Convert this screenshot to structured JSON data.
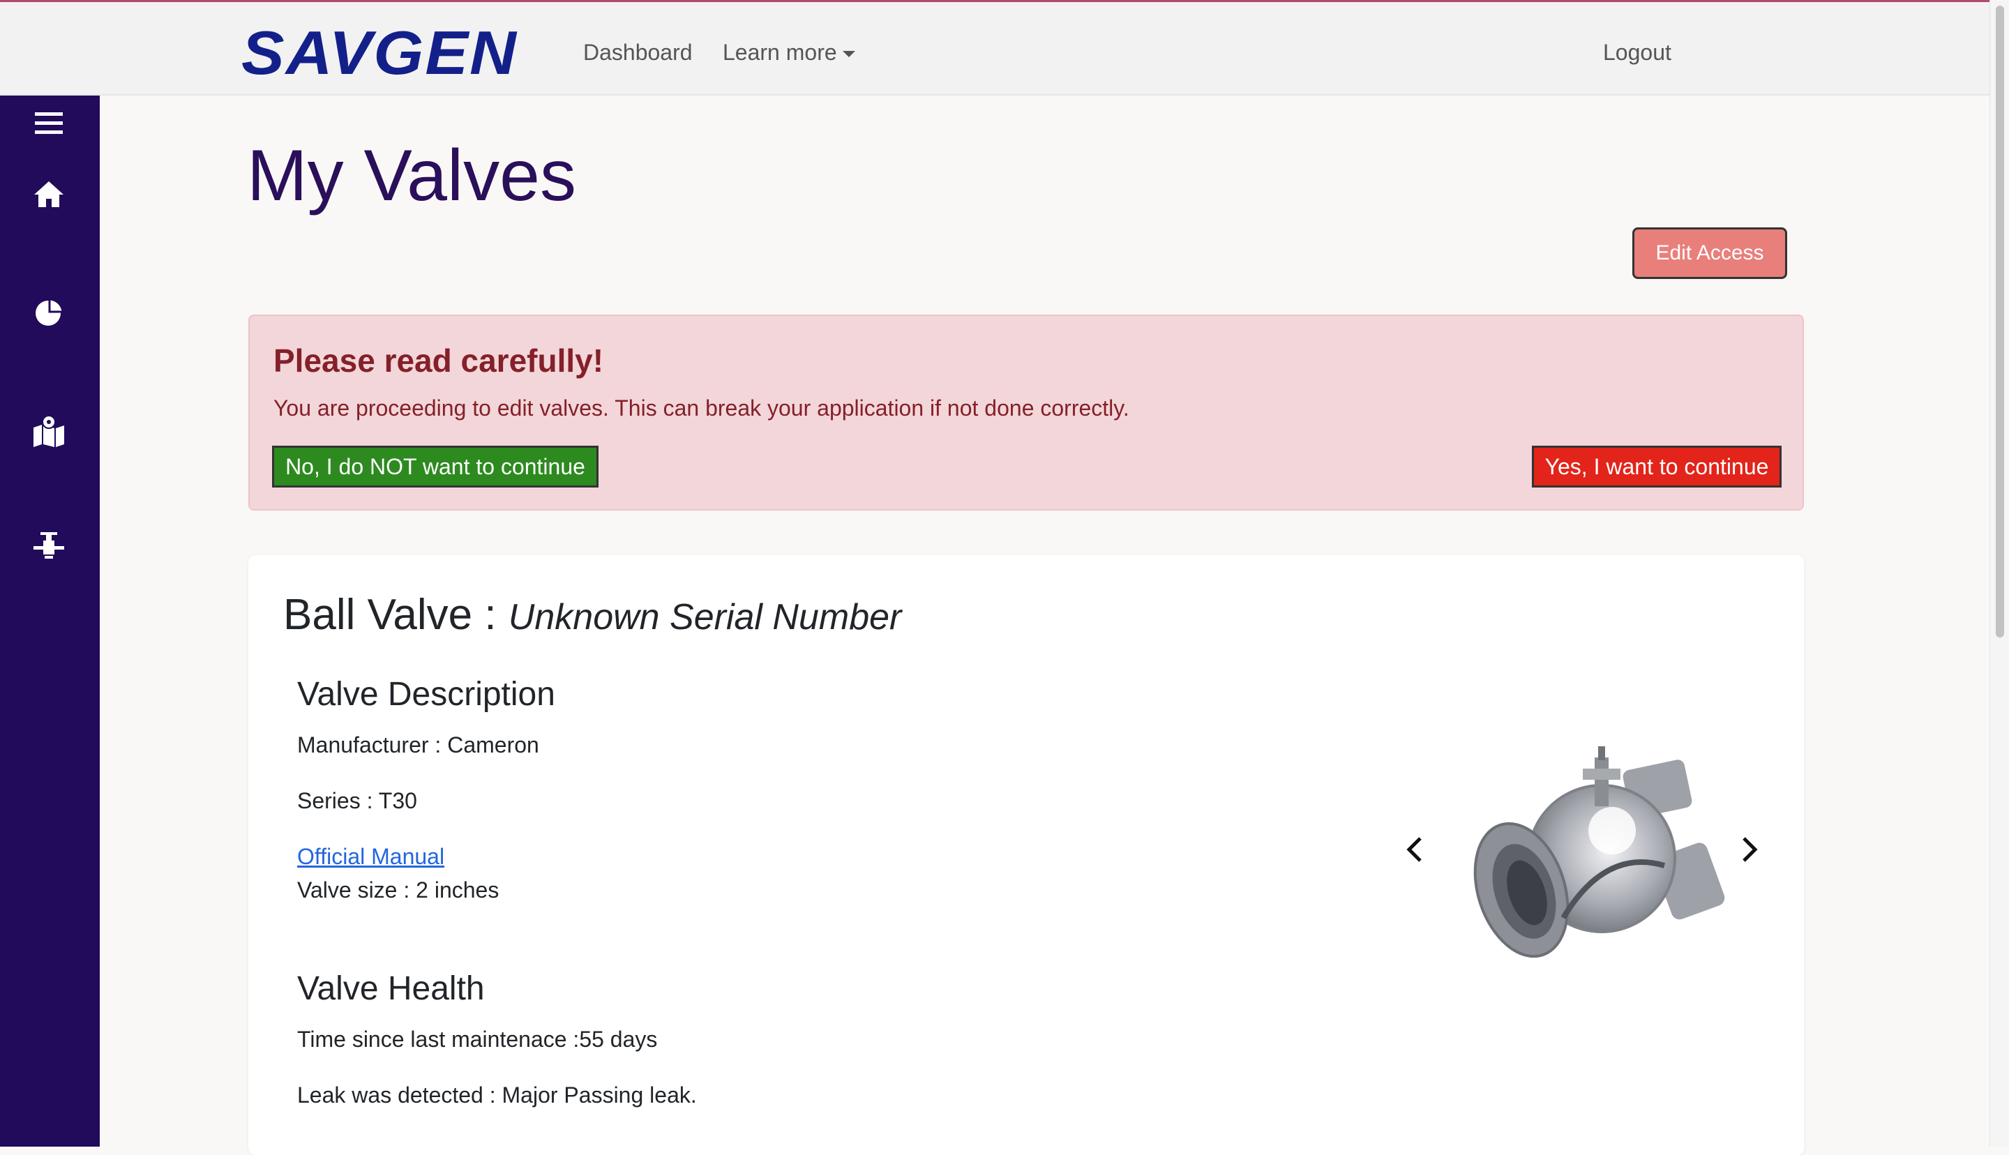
{
  "navbar": {
    "brand": "SAVGEN",
    "links": {
      "dashboard": "Dashboard",
      "learn_more": "Learn more",
      "logout": "Logout"
    }
  },
  "sidebar": {
    "items": [
      "menu-icon",
      "home-icon",
      "chart-pie-icon",
      "map-location-icon",
      "pipeline-valve-icon"
    ]
  },
  "page": {
    "title": "My Valves",
    "edit_access_label": "Edit Access"
  },
  "alert": {
    "heading": "Please read carefully!",
    "message": "You are proceeding to edit valves. This can break your application if not done correctly.",
    "no_label": "No, I do NOT want to continue",
    "yes_label": "Yes, I want to continue"
  },
  "valve": {
    "type": "Ball Valve :",
    "serial": "Unknown Serial Number",
    "description_heading": "Valve Description",
    "manufacturer": "Manufacturer : Cameron",
    "series": "Series : T30",
    "manual_link": "Official Manual",
    "size": "Valve size : 2 inches",
    "health_heading": "Valve Health",
    "time_since_maintenance": "Time since last maintenace :55 days",
    "leak_status": "Leak was detected : Major Passing leak."
  },
  "colors": {
    "sidebar": "#210b5a",
    "brand": "#14208a",
    "title": "#2a0f5a",
    "alert_bg": "#f3d6d9",
    "alert_text": "#842029",
    "no_button": "#2d8a1f",
    "yes_button": "#e3241a",
    "edit_access": "#e97f7b"
  }
}
